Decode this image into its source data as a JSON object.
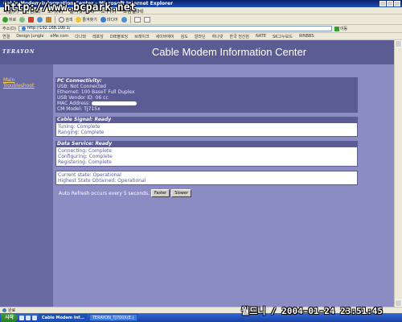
{
  "window": {
    "title": "Cable Modem Information Center - Microsoft Internet Explorer"
  },
  "menubar": {
    "items": [
      "파일(F)",
      "편집(E)",
      "보기(V)",
      "즐겨찾기(A)",
      "도구(T)",
      "도움말(H)"
    ]
  },
  "toolbar": {
    "back_label": "뒤로",
    "search_label": "검색",
    "favorites_label": "즐겨찾기",
    "media_label": "미디어"
  },
  "address": {
    "label": "주소(D)",
    "url": "http://192.168.100.1/",
    "go_label": "이동"
  },
  "links": {
    "label": "연결",
    "items": [
      "Design Jungle",
      "eMe.com",
      "다나와",
      "레포앙",
      "DIE블로딩",
      "브레이크",
      "세이버에이",
      "검도",
      "알라딘",
      "하나넷",
      "한국 전산원",
      "NATE",
      "SK그누보드",
      "WNBBS"
    ]
  },
  "watermark": "http://www.bcpark.net",
  "page": {
    "logo": "TERAYON",
    "title": "Cable Modem Information Center",
    "nav": {
      "main": "Main",
      "troubleshoot": "Troubleshoot"
    },
    "pc_connectivity": {
      "heading": "PC Connectivity:",
      "usb": "USB: Not Connected",
      "ethernet": "Ethernet: 100 BaseT Full Duplex",
      "usb_vendor": "USB Vendor ID: 06 cc",
      "mac_label": "MAC Address:",
      "cm_model": "CM Model: TJ715x"
    },
    "cable_signal": {
      "heading": "Cable Signal: Ready",
      "tuning": "Tuning: Complete",
      "ranging": "Ranging: Complete"
    },
    "data_service": {
      "heading": "Data Service: Ready",
      "connecting": "Connecting: Complete",
      "configuring": "Configuring: Complete",
      "registering": "Registering: Complete"
    },
    "state": {
      "current": "Current state: Operational",
      "highest": "Highest State Obtained: Operational"
    },
    "refresh": {
      "text": "Auto Refresh occurs every 5 seconds.",
      "faster": "Faster",
      "slower": "Slower"
    }
  },
  "status": {
    "text": "완료"
  },
  "taskbar": {
    "start": "시작",
    "tasks": [
      "Cable Modem Inf...",
      "TERAYON_TJ700X(E:)"
    ]
  },
  "datestamp": "월드니 / 2004-01-24 23:51:45"
}
